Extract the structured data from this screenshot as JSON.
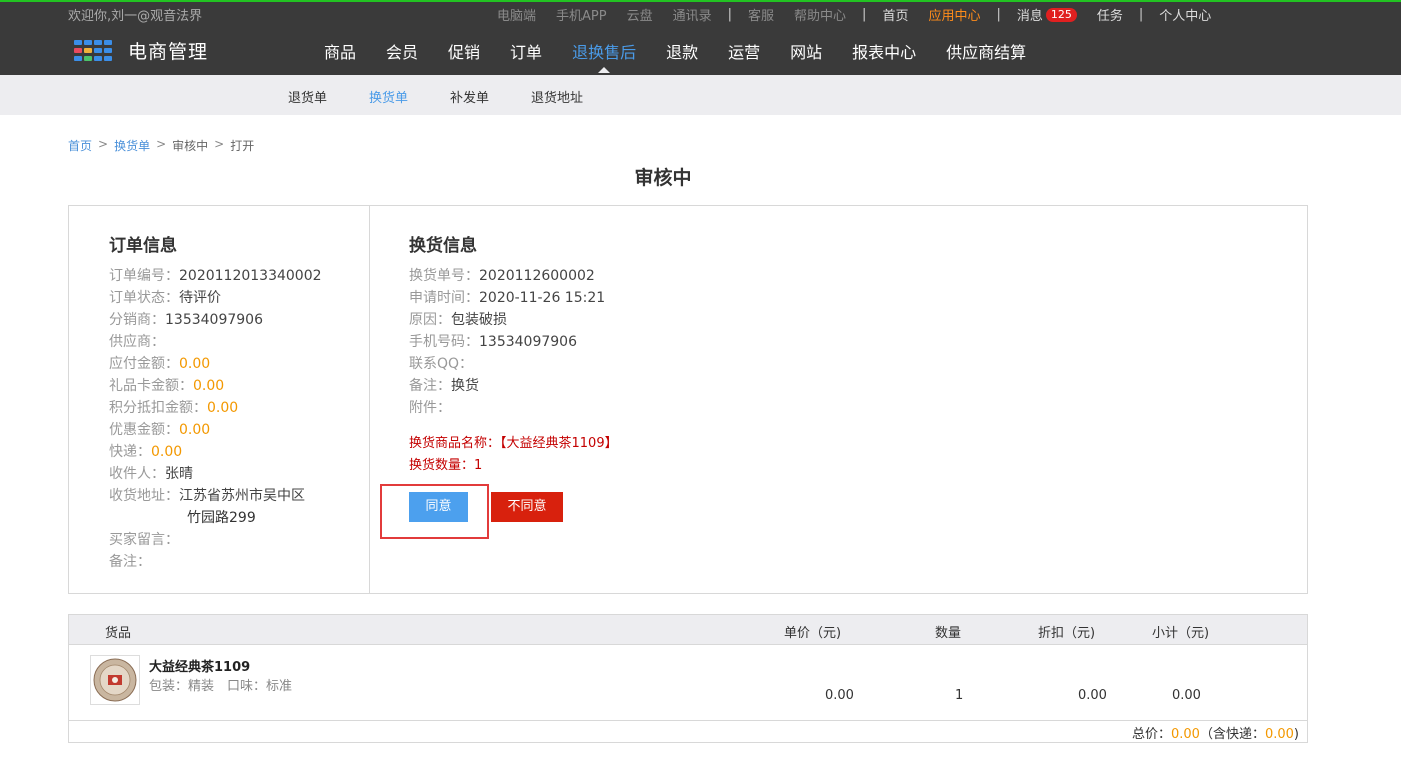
{
  "header": {
    "welcome": "欢迎你,刘一@观音法界",
    "links_gray": [
      "电脑端",
      "手机APP",
      "云盘",
      "通讯录"
    ],
    "service_links": [
      "客服",
      "帮助中心"
    ],
    "home": "首页",
    "app_center": "应用中心",
    "messages_label": "消息",
    "messages_count": "125",
    "tasks": "任务",
    "personal_center": "个人中心",
    "logo_text": "电商管理"
  },
  "main_nav": [
    {
      "label": "商品"
    },
    {
      "label": "会员"
    },
    {
      "label": "促销"
    },
    {
      "label": "订单"
    },
    {
      "label": "退换售后",
      "active": true
    },
    {
      "label": "退款"
    },
    {
      "label": "运营"
    },
    {
      "label": "网站"
    },
    {
      "label": "报表中心"
    },
    {
      "label": "供应商结算"
    }
  ],
  "sub_nav": [
    {
      "label": "退货单"
    },
    {
      "label": "换货单",
      "active": true
    },
    {
      "label": "补发单"
    },
    {
      "label": "退货地址"
    }
  ],
  "breadcrumb": {
    "home": "首页",
    "list": "换货单",
    "status": "审核中",
    "current": "打开",
    "sep": ">"
  },
  "page_title": "审核中",
  "order_info": {
    "title": "订单信息",
    "order_no_label": "订单编号：",
    "order_no": "2020112013340002",
    "status_label": "订单状态：",
    "status": "待评价",
    "distributor_label": "分销商：",
    "distributor": "13534097906",
    "supplier_label": "供应商：",
    "payable_label": "应付金额：",
    "payable": "0.00",
    "gift_card_label": "礼品卡金额：",
    "gift_card": "0.00",
    "points_label": "积分抵扣金额：",
    "points": "0.00",
    "discount_label": "优惠金额：",
    "discount": "0.00",
    "shipping_label": "快递：",
    "shipping": "0.00",
    "receiver_label": "收件人：",
    "receiver": "张晴",
    "address_label": "收货地址：",
    "address_line1": "江苏省苏州市吴中区",
    "address_line2": "竹园路299",
    "buyer_msg_label": "买家留言：",
    "remark_label": "备注："
  },
  "exchange_info": {
    "title": "换货信息",
    "exchange_no_label": "换货单号：",
    "exchange_no": "2020112600002",
    "apply_time_label": "申请时间：",
    "apply_time": "2020-11-26 15:21",
    "reason_label": "原因：",
    "reason": "包装破损",
    "phone_label": "手机号码：",
    "phone": "13534097906",
    "qq_label": "联系QQ：",
    "remark_label": "备注：",
    "remark": "换货",
    "attachment_label": "附件：",
    "product_line": "换货商品名称：【大益经典茶1109】",
    "qty_line": "换货数量：1",
    "agree_label": "同意",
    "reject_label": "不同意"
  },
  "table": {
    "headers": {
      "product": "货品",
      "price": "单价（元)",
      "qty": "数量",
      "discount": "折扣（元)",
      "subtotal": "小计（元)"
    },
    "rows": [
      {
        "name": "大益经典茶1109",
        "spec": "包装：精装　口味：标准",
        "price": "0.00",
        "qty": "1",
        "discount": "0.00",
        "subtotal": "0.00"
      }
    ],
    "total_prefix": "总价：",
    "total": "0.00",
    "shipping_prefix": "（含快递：",
    "shipping": "0.00",
    "shipping_suffix": ")"
  },
  "colors": {
    "accent": "#4a9be8",
    "orange": "#f39800",
    "red": "#d8210d",
    "green_top": "#22c322"
  }
}
